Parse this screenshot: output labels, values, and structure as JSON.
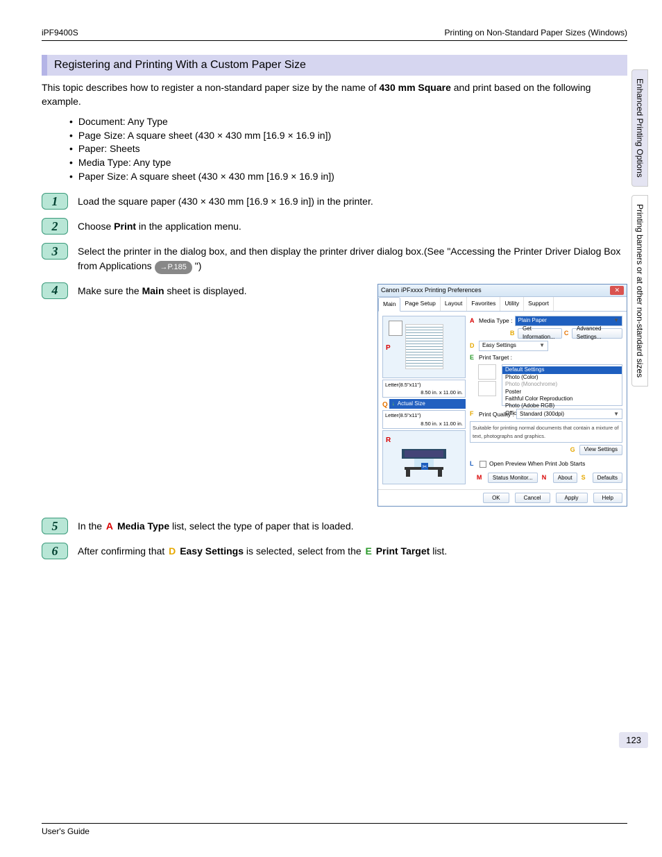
{
  "header": {
    "left": "iPF9400S",
    "right": "Printing on Non-Standard Paper Sizes (Windows)"
  },
  "sectionTitle": "Registering and Printing With a Custom Paper Size",
  "intro1": "This topic describes how to register a non-standard paper size by the name of ",
  "intro_bold": "430 mm Square",
  "intro2": " and print based on the following example.",
  "specs": [
    "Document: Any Type",
    "Page Size: A square sheet (430 × 430 mm [16.9 × 16.9 in])",
    "Paper: Sheets",
    "Media Type: Any type",
    "Paper Size: A square sheet (430 × 430 mm [16.9 × 16.9 in])"
  ],
  "steps": {
    "1": "Load the square paper (430 × 430 mm [16.9 × 16.9 in]) in the printer.",
    "2a": "Choose ",
    "2b": "Print",
    "2c": " in the application menu.",
    "3a": "Select the printer in the dialog box, and then display the printer driver dialog box.(See \"Accessing the Printer Driver Dialog Box from Applications ",
    "3ref": "→P.185",
    "3b": " \")",
    "4a": "Make sure the ",
    "4b": "Main",
    "4c": " sheet is displayed.",
    "5a": "In the ",
    "5b": "Media Type",
    "5c": " list, select the type of paper that is loaded.",
    "6a": "After confirming that ",
    "6b": "Easy Settings",
    "6c": " is selected, select from the ",
    "6d": "Print Target",
    "6e": " list."
  },
  "dialog": {
    "title": "Canon iPFxxxx Printing Preferences",
    "tabs": [
      "Main",
      "Page Setup",
      "Layout",
      "Favorites",
      "Utility",
      "Support"
    ],
    "mediaTypeLabel": "Media Type :",
    "mediaTypeValue": "Plain Paper",
    "getInfoBtn": "Get Information...",
    "advBtn": "Advanced Settings...",
    "easySettings": "Easy Settings",
    "printTargetLabel": "Print Target :",
    "targets": [
      "Default Settings",
      "Photo (Color)",
      "Photo (Monochrome)",
      "Poster",
      "Faithful Color Reproduction",
      "Photo (Adobe RGB)",
      "Office Document"
    ],
    "printQualityLabel": "Print Quality :",
    "printQualityValue": "Standard (300dpi)",
    "desc": "Suitable for printing normal documents that contain a mixture of text, photographs and graphics.",
    "viewSettings": "View Settings",
    "openPreview": "Open Preview When Print Job Starts",
    "statusMonitor": "Status Monitor...",
    "about": "About",
    "defaults": "Defaults",
    "ok": "OK",
    "cancel": "Cancel",
    "apply": "Apply",
    "help": "Help",
    "letterSize": "Letter(8.5\"x11\")",
    "dims": "8.50 in. x 11.00 in.",
    "actualSize": "Actual Size"
  },
  "sideTabs": {
    "t1": "Enhanced Printing Options",
    "t2": "Printing banners or at other non-standard sizes"
  },
  "pageNum": "123",
  "footer": "User's Guide"
}
